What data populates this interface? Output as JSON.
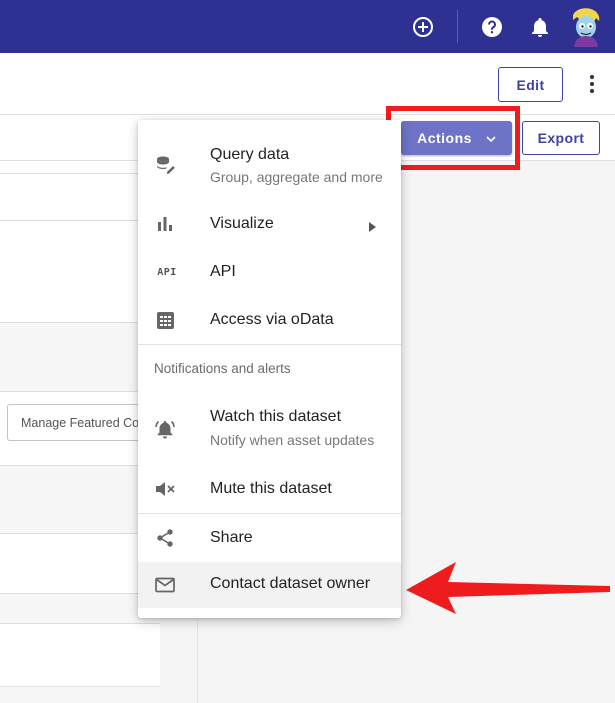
{
  "colors": {
    "appbar": "#2e3192",
    "accent": "#3f43a6",
    "actions_button": "#6f73c7",
    "annotation_red": "#ee1c1c"
  },
  "appbar": {
    "icons": [
      "add-circle-icon",
      "help-icon",
      "notifications-icon",
      "avatar"
    ]
  },
  "header": {
    "edit_label": "Edit"
  },
  "toolbar": {
    "actions_label": "Actions",
    "export_label": "Export"
  },
  "background": {
    "featured_input_placeholder": "Manage Featured Co"
  },
  "menu": {
    "items": [
      {
        "icon": "database-edit-icon",
        "label": "Query data",
        "sub": "Group, aggregate and more"
      },
      {
        "icon": "bar-chart-icon",
        "label": "Visualize",
        "has_submenu": true
      },
      {
        "icon": "api-icon",
        "label": "API"
      },
      {
        "icon": "grid-icon",
        "label": "Access via oData"
      }
    ],
    "section_title": "Notifications and alerts",
    "alert_items": [
      {
        "icon": "alarm-bell-icon",
        "label": "Watch this dataset",
        "sub": "Notify when asset updates"
      },
      {
        "icon": "volume-off-icon",
        "label": "Mute this dataset"
      }
    ],
    "share_items": [
      {
        "icon": "share-icon",
        "label": "Share"
      },
      {
        "icon": "mail-icon",
        "label": "Contact dataset owner",
        "highlighted": true
      }
    ],
    "api_glyph": "API"
  }
}
